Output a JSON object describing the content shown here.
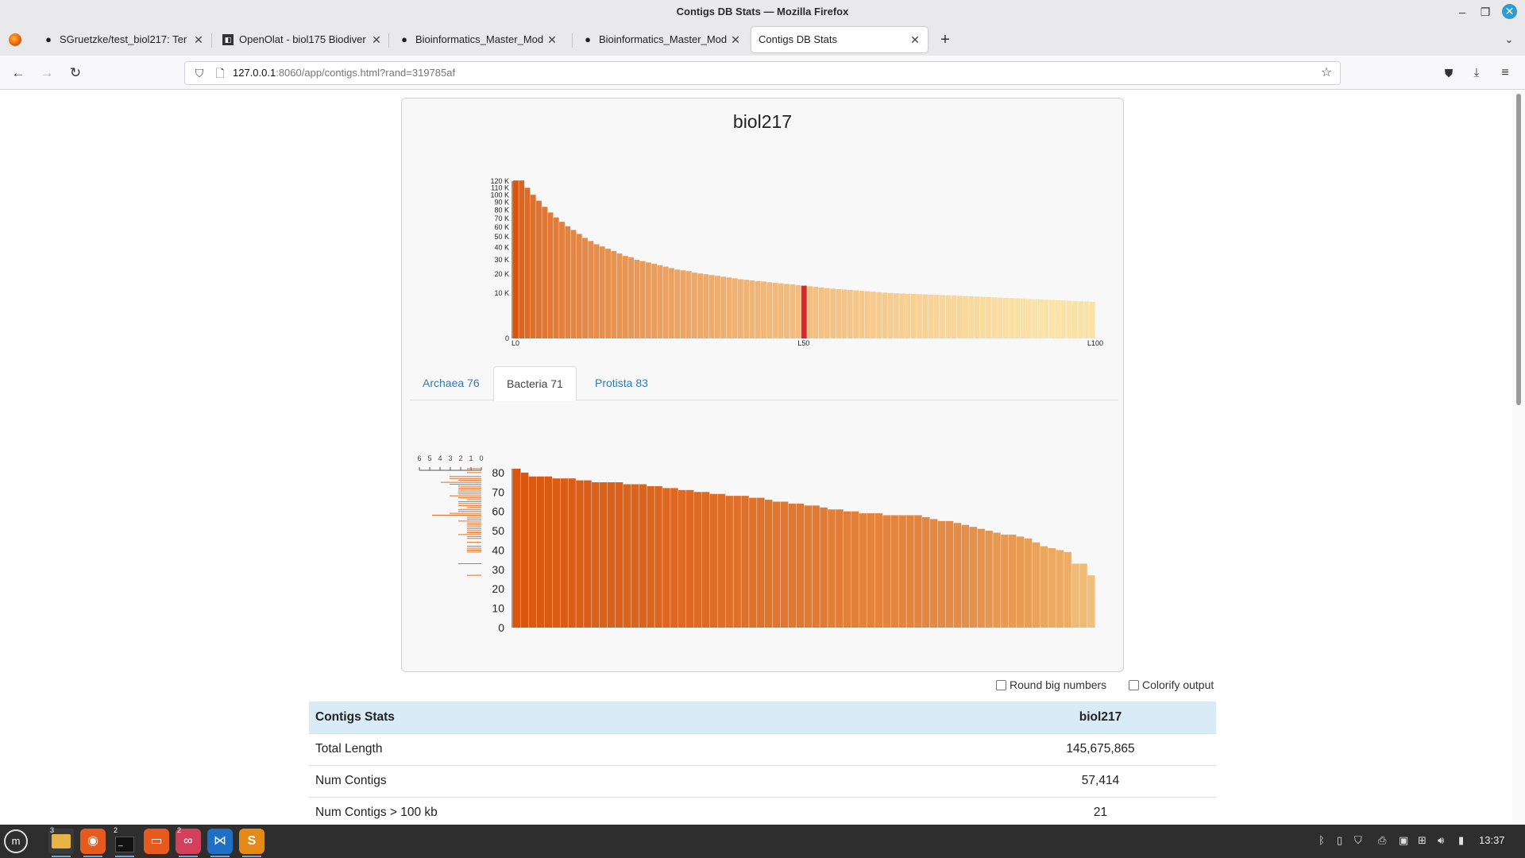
{
  "window": {
    "title": "Contigs DB Stats — Mozilla Firefox"
  },
  "tabs": [
    {
      "label": "SGruetzke/test_biol217: Ter",
      "icon": "github-icon"
    },
    {
      "label": "OpenOlat - biol175 Biodiver",
      "icon": "openolat-icon"
    },
    {
      "label": "Bioinformatics_Master_Mod",
      "icon": "github-icon"
    },
    {
      "label": "Bioinformatics_Master_Mod",
      "icon": "github-icon"
    },
    {
      "label": "Contigs DB Stats",
      "icon": ""
    }
  ],
  "url": {
    "host": "127.0.0.1",
    "rest": ":8060/app/contigs.html?rand=319785af"
  },
  "card": {
    "title": "biol217"
  },
  "length_chart": {
    "type": "bar",
    "y_ticks": [
      "120 K",
      "110 K",
      "100 K",
      "90 K",
      "80 K",
      "70 K",
      "60 K",
      "50 K",
      "40 K",
      "30 K",
      "20 K",
      "10 K",
      "0"
    ],
    "x_ticks": [
      "L0",
      "L50",
      "L100"
    ],
    "highlight_index": 50,
    "values_k": [
      121,
      121,
      110,
      100,
      92,
      84,
      77,
      71,
      66,
      61,
      57,
      53,
      49,
      46,
      43,
      41,
      39,
      37,
      35,
      33,
      32,
      30,
      29,
      28,
      27,
      26,
      25,
      24,
      23,
      22.5,
      22,
      21,
      20.5,
      20,
      19.5,
      19,
      18.5,
      18,
      17.5,
      17,
      16.7,
      16.3,
      16,
      15.7,
      15.3,
      15,
      14.7,
      14.4,
      14.1,
      13.8,
      13.5,
      13.2,
      12.9,
      12.6,
      12.3,
      12,
      11.8,
      11.6,
      11.4,
      11.2,
      11,
      10.8,
      10.6,
      10.4,
      10.2,
      10,
      9.9,
      9.8,
      9.7,
      9.6,
      9.5,
      9.4,
      9.3,
      9.2,
      9.1,
      9,
      8.9,
      8.8,
      8.7,
      8.6,
      8.5,
      8.4,
      8.3,
      8.2,
      8.1,
      8,
      7.9,
      7.8,
      7.7,
      7.6,
      7.5,
      7.4,
      7.3,
      7.2,
      7.1,
      7,
      6.9,
      6.8,
      6.7,
      6.6,
      6.5
    ]
  },
  "domain_tabs": [
    {
      "label": "Archaea 76",
      "active": false
    },
    {
      "label": "Bacteria 71",
      "active": true
    },
    {
      "label": "Protista 83",
      "active": false
    }
  ],
  "completion_chart": {
    "type": "bar",
    "y_ticks": [
      "80",
      "70",
      "60",
      "50",
      "40",
      "30",
      "20",
      "10",
      "0"
    ],
    "hist_ticks": [
      "6",
      "5",
      "4",
      "3",
      "2",
      "1",
      "0"
    ],
    "values": [
      82,
      80,
      78,
      78,
      78,
      77,
      77,
      77,
      76,
      76,
      75,
      75,
      75,
      75,
      74,
      74,
      74,
      73,
      73,
      72,
      72,
      71,
      71,
      70,
      70,
      69,
      69,
      68,
      68,
      68,
      67,
      67,
      66,
      65,
      65,
      64,
      64,
      63,
      63,
      62,
      61,
      61,
      60,
      60,
      59,
      59,
      59,
      58,
      58,
      58,
      58,
      58,
      57,
      56,
      55,
      55,
      54,
      53,
      52,
      51,
      50,
      49,
      48,
      48,
      47,
      46,
      44,
      42,
      41,
      40,
      39,
      33,
      33,
      27
    ]
  },
  "options": {
    "round_label": "Round big numbers",
    "colorify_label": "Colorify output"
  },
  "stats": {
    "header": [
      "Contigs Stats",
      "biol217"
    ],
    "rows": [
      {
        "label": "Total Length",
        "value": "145,675,865"
      },
      {
        "label": "Num Contigs",
        "value": "57,414"
      },
      {
        "label": "Num Contigs > 100 kb",
        "value": "21"
      }
    ]
  },
  "taskbar": {
    "clock": "13:37",
    "badges": [
      "3",
      "2",
      "2"
    ]
  },
  "colors": {
    "bar_dark": "#d9560f",
    "bar_light": "#fbe3a8",
    "highlight": "#d9262c",
    "link": "#337ab7",
    "table_header": "#d9ecf5"
  }
}
